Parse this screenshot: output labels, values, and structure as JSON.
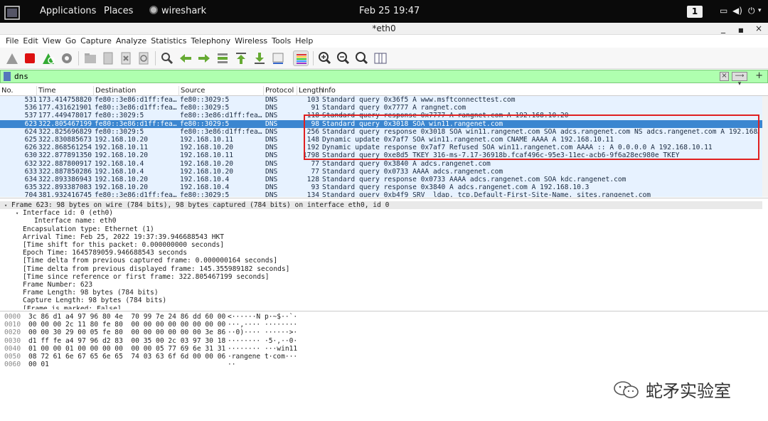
{
  "topbar": {
    "applications": "Applications",
    "places": "Places",
    "app_name": "wireshark",
    "clock": "Feb 25  19:47",
    "workspace": "1"
  },
  "window": {
    "title": "*eth0"
  },
  "menu": [
    "File",
    "Edit",
    "View",
    "Go",
    "Capture",
    "Analyze",
    "Statistics",
    "Telephony",
    "Wireless",
    "Tools",
    "Help"
  ],
  "filter": {
    "value": "dns"
  },
  "columns": [
    "No.",
    "Time",
    "Destination",
    "Source",
    "Protocol",
    "Length",
    "Info"
  ],
  "packets": [
    {
      "no": "531",
      "time": "173.414758820",
      "dst": "fe80::3e86:d1ff:fea…",
      "src": "fe80::3029:5",
      "proto": "DNS",
      "len": "103",
      "info": "Standard query 0x36f5 A www.msftconnecttest.com"
    },
    {
      "no": "536",
      "time": "177.431621901",
      "dst": "fe80::3e86:d1ff:fea…",
      "src": "fe80::3029:5",
      "proto": "DNS",
      "len": "91",
      "info": "Standard query 0x7777 A rangnet.com"
    },
    {
      "no": "537",
      "time": "177.449478017",
      "dst": "fe80::3029:5",
      "src": "fe80::3e86:d1ff:fea…",
      "proto": "DNS",
      "len": "118",
      "info": "Standard query response 0x7777 A rangnet.com A 192.168.10.20"
    },
    {
      "no": "623",
      "time": "322.805467199",
      "dst": "fe80::3e86:d1ff:fea…",
      "src": "fe80::3029:5",
      "proto": "DNS",
      "len": "98",
      "info": "Standard query 0x3018 SOA win11.rangenet.com"
    },
    {
      "no": "624",
      "time": "322.825696829",
      "dst": "fe80::3029:5",
      "src": "fe80::3e86:d1ff:fea…",
      "proto": "DNS",
      "len": "256",
      "info": "Standard query response 0x3018 SOA win11.rangenet.com SOA adcs.rangenet.com NS adcs.rangenet.com A 192.168…"
    },
    {
      "no": "625",
      "time": "322.830885673",
      "dst": "192.168.10.20",
      "src": "192.168.10.11",
      "proto": "DNS",
      "len": "148",
      "info": "Dynamic update 0x7af7 SOA win11.rangenet.com CNAME AAAA A 192.168.10.11"
    },
    {
      "no": "626",
      "time": "322.868561254",
      "dst": "192.168.10.11",
      "src": "192.168.10.20",
      "proto": "DNS",
      "len": "192",
      "info": "Dynamic update response 0x7af7 Refused SOA win11.rangenet.com AAAA :: A 0.0.0.0 A 192.168.10.11"
    },
    {
      "no": "630",
      "time": "322.877891350",
      "dst": "192.168.10.20",
      "src": "192.168.10.11",
      "proto": "DNS",
      "len": "1798",
      "info": "Standard query 0xe8d5 TKEY 316-ms-7.17-36918b.fcaf496c-95e3-11ec-acb6-9f6a28ec980e TKEY"
    },
    {
      "no": "632",
      "time": "322.887800917",
      "dst": "192.168.10.4",
      "src": "192.168.10.20",
      "proto": "DNS",
      "len": "77",
      "info": "Standard query 0x3840 A adcs.rangenet.com"
    },
    {
      "no": "633",
      "time": "322.887850286",
      "dst": "192.168.10.4",
      "src": "192.168.10.20",
      "proto": "DNS",
      "len": "77",
      "info": "Standard query 0x0733 AAAA adcs.rangenet.com"
    },
    {
      "no": "634",
      "time": "322.893386943",
      "dst": "192.168.10.20",
      "src": "192.168.10.4",
      "proto": "DNS",
      "len": "128",
      "info": "Standard query response 0x0733 AAAA adcs.rangenet.com SOA kdc.rangenet.com"
    },
    {
      "no": "635",
      "time": "322.893387083",
      "dst": "192.168.10.20",
      "src": "192.168.10.4",
      "proto": "DNS",
      "len": "93",
      "info": "Standard query response 0x3840 A adcs.rangenet.com A 192.168.10.3"
    },
    {
      "no": "704",
      "time": "381.932416745",
      "dst": "fe80::3e86:d1ff:fea…",
      "src": "fe80::3029:5",
      "proto": "DNS",
      "len": "134",
      "info": "Standard query 0xb4f9 SRV _ldap._tcp.Default-First-Site-Name._sites.rangenet.com"
    }
  ],
  "selected_packet": "623",
  "details": [
    {
      "text": "Frame 623: 98 bytes on wire (784 bits), 98 bytes captured (784 bits) on interface eth0, id 0",
      "indent": 0,
      "expander": "▾"
    },
    {
      "text": "Interface id: 0 (eth0)",
      "indent": 1,
      "expander": "▾"
    },
    {
      "text": "Interface name: eth0",
      "indent": 2,
      "expander": ""
    },
    {
      "text": "Encapsulation type: Ethernet (1)",
      "indent": 1,
      "expander": ""
    },
    {
      "text": "Arrival Time: Feb 25, 2022 19:37:39.946688543 HKT",
      "indent": 1,
      "expander": ""
    },
    {
      "text": "[Time shift for this packet: 0.000000000 seconds]",
      "indent": 1,
      "expander": ""
    },
    {
      "text": "Epoch Time: 1645789059.946688543 seconds",
      "indent": 1,
      "expander": ""
    },
    {
      "text": "[Time delta from previous captured frame: 0.000000164 seconds]",
      "indent": 1,
      "expander": ""
    },
    {
      "text": "[Time delta from previous displayed frame: 145.355989182 seconds]",
      "indent": 1,
      "expander": ""
    },
    {
      "text": "[Time since reference or first frame: 322.805467199 seconds]",
      "indent": 1,
      "expander": ""
    },
    {
      "text": "Frame Number: 623",
      "indent": 1,
      "expander": ""
    },
    {
      "text": "Frame Length: 98 bytes (784 bits)",
      "indent": 1,
      "expander": ""
    },
    {
      "text": "Capture Length: 98 bytes (784 bits)",
      "indent": 1,
      "expander": ""
    },
    {
      "text": "[Frame is marked: False]",
      "indent": 1,
      "expander": ""
    }
  ],
  "bytes": [
    {
      "offset": "0000",
      "hex": "3c 86 d1 a4 97 96 80 4e  70 99 7e 24 86 dd 60 00",
      "ascii": "<······N p·~$··`·"
    },
    {
      "offset": "0010",
      "hex": "00 00 00 2c 11 80 fe 80  00 00 00 00 00 00 00 00",
      "ascii": "···,···· ········"
    },
    {
      "offset": "0020",
      "hex": "00 00 30 29 00 05 fe 80  00 00 00 00 00 00 3e 86",
      "ascii": "··0)···· ······>·"
    },
    {
      "offset": "0030",
      "hex": "d1 ff fe a4 97 96 d2 83  00 35 00 2c 03 97 30 18",
      "ascii": "········ ·5·,··0·"
    },
    {
      "offset": "0040",
      "hex": "01 00 00 01 00 00 00 00  00 00 05 77 69 6e 31 31",
      "ascii": "········ ···win11"
    },
    {
      "offset": "0050",
      "hex": "08 72 61 6e 67 65 6e 65  74 03 63 6f 6d 00 00 06",
      "ascii": "·rangene t·com···"
    },
    {
      "offset": "0060",
      "hex": "00 01",
      "ascii": "··"
    }
  ],
  "watermark": "蛇矛实验室",
  "colors": {
    "row_bg": "#e7f2ff",
    "selected": "#3b86d0",
    "filter_ok": "#afffaf",
    "highlight_box": "#e02020"
  }
}
